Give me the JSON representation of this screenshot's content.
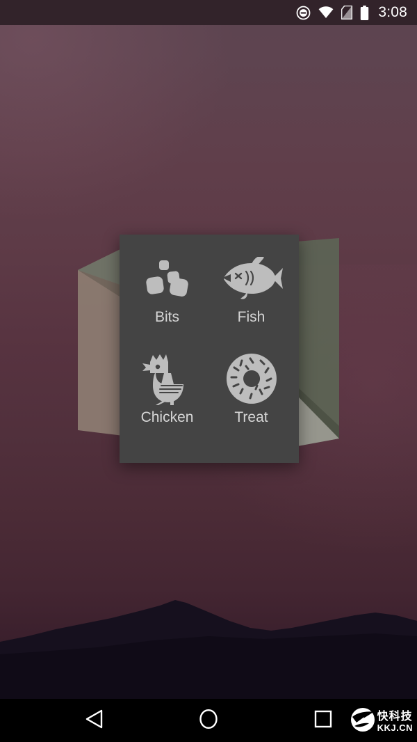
{
  "status_bar": {
    "time": "3:08",
    "background_color": "#32232a",
    "icons": [
      {
        "name": "do-not-disturb-icon",
        "label": "Do not disturb"
      },
      {
        "name": "wifi-icon",
        "label": "Wi-Fi"
      },
      {
        "name": "no-sim-icon",
        "label": "No SIM card"
      },
      {
        "name": "battery-icon",
        "label": "Battery full"
      }
    ]
  },
  "wallpaper": {
    "name": "android-sunset-mountains-wallpaper",
    "top_color": "#5c4450",
    "bottom_color": "#2d1824",
    "mountain_color": "#16101e"
  },
  "origami": {
    "name": "paper-fold-decoration",
    "left_top_color": "#6c7063",
    "left_bottom_color": "#8b7a70",
    "right_main_color": "#5c6353",
    "right_bottom_color": "#9a9a92"
  },
  "dialog": {
    "name": "cat-food-picker-dialog",
    "background_color": "#444444",
    "label_color": "#d6d6d6",
    "icon_color": "#bdbdbd",
    "items": [
      {
        "label": "Bits",
        "icon": "bits-icon"
      },
      {
        "label": "Fish",
        "icon": "fish-icon"
      },
      {
        "label": "Chicken",
        "icon": "chicken-icon"
      },
      {
        "label": "Treat",
        "icon": "donut-treat-icon"
      }
    ]
  },
  "nav_bar": {
    "background_color": "#000000",
    "buttons": [
      {
        "name": "back-button",
        "label": "Back"
      },
      {
        "name": "home-button",
        "label": "Home"
      },
      {
        "name": "recents-button",
        "label": "Recent apps"
      }
    ],
    "watermark": {
      "cn": "快科技",
      "en": "KKJ.CN"
    }
  }
}
